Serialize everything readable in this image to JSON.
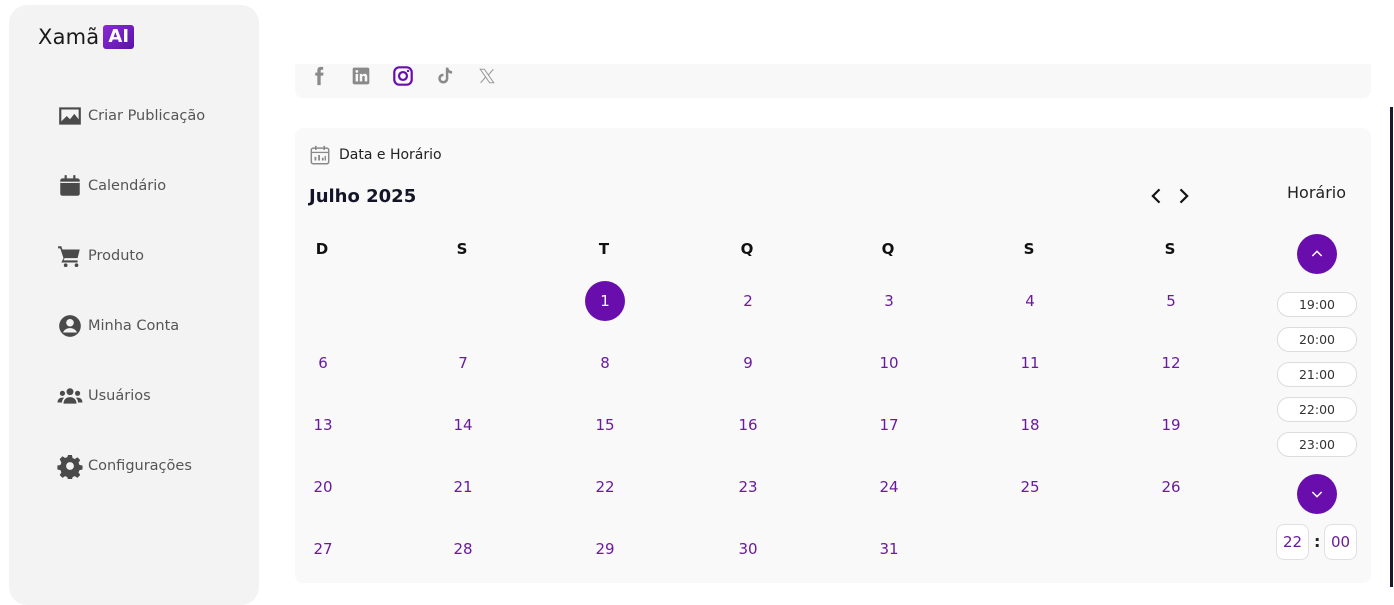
{
  "app": {
    "logo_text": "Xamã",
    "logo_badge": "AI"
  },
  "sidebar": {
    "items": [
      {
        "label": "Criar Publicação",
        "icon": "image-icon"
      },
      {
        "label": "Calendário",
        "icon": "calendar-icon"
      },
      {
        "label": "Produto",
        "icon": "cart-icon"
      },
      {
        "label": "Minha Conta",
        "icon": "account-icon"
      },
      {
        "label": "Usuários",
        "icon": "users-icon"
      },
      {
        "label": "Configurações",
        "icon": "gear-icon"
      }
    ]
  },
  "social": {
    "networks": [
      "facebook-icon",
      "linkedin-icon",
      "instagram-icon",
      "tiktok-icon",
      "x-icon"
    ],
    "active": "instagram-icon"
  },
  "schedule": {
    "section_title": "Data e Horário",
    "month_label": "Julho 2025",
    "weekdays": [
      "D",
      "S",
      "T",
      "Q",
      "Q",
      "S",
      "S"
    ],
    "weeks": [
      [
        "",
        "",
        "1",
        "2",
        "3",
        "4",
        "5"
      ],
      [
        "6",
        "7",
        "8",
        "9",
        "10",
        "11",
        "12"
      ],
      [
        "13",
        "14",
        "15",
        "16",
        "17",
        "18",
        "19"
      ],
      [
        "20",
        "21",
        "22",
        "23",
        "24",
        "25",
        "26"
      ],
      [
        "27",
        "28",
        "29",
        "30",
        "31",
        "",
        ""
      ]
    ],
    "selected_day": "1",
    "time_title": "Horário",
    "time_slots": [
      "19:00",
      "20:00",
      "21:00",
      "22:00",
      "23:00"
    ],
    "hour": "22",
    "minute": "00",
    "separator": ":"
  },
  "colors": {
    "accent": "#6a0dad",
    "day_text": "#6a1b9a",
    "sidebar_bg": "#f3f3f3"
  }
}
